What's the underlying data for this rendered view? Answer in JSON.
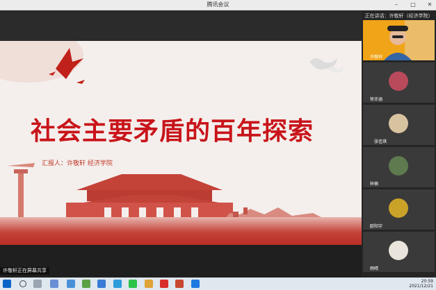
{
  "window": {
    "title": "腾讯会议"
  },
  "slide": {
    "title": "社会主要矛盾的百年探索",
    "reporter": "汇报人：许敬轩 经济学院"
  },
  "panel": {
    "title": "正在讲话：许敬轩（经济学院）",
    "participants": [
      {
        "name": "许敬轩",
        "kind": "video"
      },
      {
        "name": "徐亦涵",
        "kind": "avatar",
        "color": "#b94a5c"
      },
      {
        "name": "张佳琪",
        "kind": "avatar",
        "color": "#d8c3a0"
      },
      {
        "name": "梓楠",
        "kind": "avatar",
        "color": "#5e7a4e"
      },
      {
        "name": "欧阳宇",
        "kind": "avatar",
        "color": "#c9a227"
      },
      {
        "name": "雨晴",
        "kind": "avatar",
        "color": "#e9e4dc"
      }
    ]
  },
  "notice": "许敬轩正在屏幕共享",
  "taskbar": {
    "time": "20:59",
    "date": "2021/12/21"
  }
}
